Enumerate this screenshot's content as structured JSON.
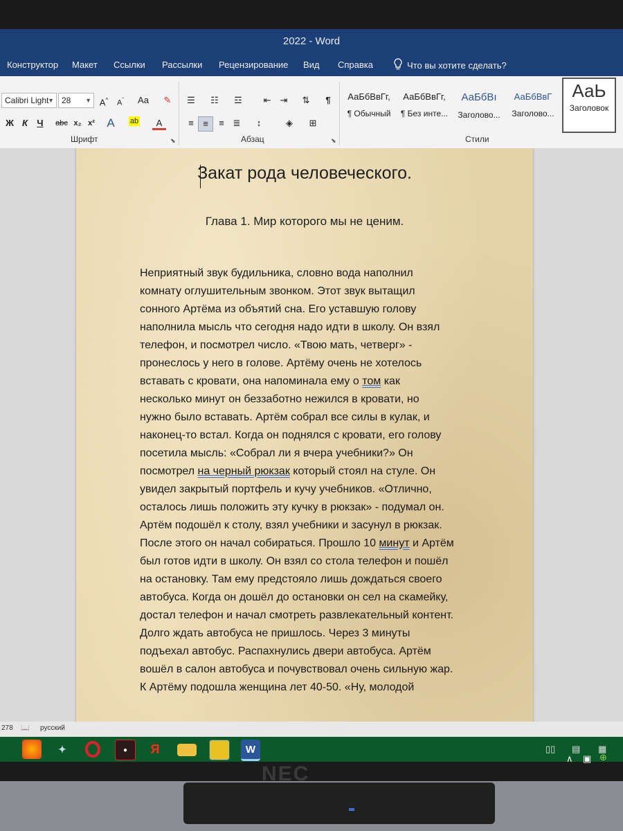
{
  "window": {
    "title": "2022 - Word"
  },
  "menu": {
    "items": [
      "Конструктор",
      "Макет",
      "Ссылки",
      "Рассылки",
      "Рецензирование",
      "Вид",
      "Справка"
    ],
    "tell_me": "Что вы хотите сделать?"
  },
  "ribbon": {
    "font_name": "Calibri Light",
    "font_size": "28",
    "change_case": "Aa",
    "bold": "Ж",
    "italic": "К",
    "underline": "Ч",
    "strike": "abc",
    "subscript": "x₂",
    "superscript": "x²",
    "font_group_label": "Шрифт",
    "paragraph_group_label": "Абзац",
    "styles_group_label": "Стили",
    "styles": [
      {
        "sample": "АаБбВвГг,",
        "name": "¶ Обычный"
      },
      {
        "sample": "АаБбВвГг,",
        "name": "¶ Без инте..."
      },
      {
        "sample": "АаБбВı",
        "name": "Заголово..."
      },
      {
        "sample": "АаБбВвГ",
        "name": "Заголово..."
      },
      {
        "sample": "АаЬ",
        "name": "Заголовок"
      }
    ]
  },
  "document": {
    "title": "Закат рода человеческого.",
    "chapter": "Глава 1. Мир которого мы не ценим.",
    "lines": [
      [
        "Неприятный звук будильника, словно вода наполнил"
      ],
      [
        "комнату оглушительным звонком. Этот звук вытащил"
      ],
      [
        "сонного Артёма из объятий сна. Его уставшую голову"
      ],
      [
        "наполнила мысль что сегодня надо идти в школу. Он взял"
      ],
      [
        "телефон, и посмотрел число. «Твою мать, четверг» -"
      ],
      [
        "пронеслось у него в голове. Артёму очень не хотелось"
      ],
      [
        "вставать с кровати, она напоминала ему о ",
        "том",
        " как"
      ],
      [
        "несколько минут он беззаботно нежился в кровати, но"
      ],
      [
        "нужно было вставать. Артём собрал все силы в кулак, и"
      ],
      [
        "наконец-то встал. Когда он поднялся с кровати, его голову"
      ],
      [
        "посетила мысль: «Собрал ли я вчера учебники?» Он"
      ],
      [
        "посмотрел ",
        "на черный рюкзак",
        " который стоял на стуле. Он"
      ],
      [
        "увидел закрытый портфель и кучу учебников. «Отлично,"
      ],
      [
        "осталось лишь положить эту кучку в рюкзак» - подумал он."
      ],
      [
        "Артём подошёл к столу, взял учебники и засунул в рюкзак."
      ],
      [
        "После этого он начал собираться. Прошло 10 ",
        "минут",
        " и Артём"
      ],
      [
        "был готов идти в школу. Он взял со стола телефон и пошёл"
      ],
      [
        "на остановку. Там ему предстояло лишь дождаться своего"
      ],
      [
        "автобуса. Когда он дошёл до остановки он сел на скамейку,"
      ],
      [
        "достал телефон и начал смотреть развлекательный контент."
      ],
      [
        "Долго ждать автобуса не пришлось. Через 3 минуты"
      ],
      [
        "подъехал автобус. Распахнулись двери автобуса. Артём"
      ],
      [
        "вошёл в салон автобуса и почувствовал очень сильную жар."
      ],
      [
        "К Артёму подошла женщина лет 40-50. «Ну, молодой"
      ]
    ]
  },
  "status": {
    "words": "278",
    "language": "русский"
  },
  "taskbar": {
    "apps": [
      "firefox-icon",
      "qbittorrent-icon",
      "opera-icon",
      "camera-app-icon",
      "yandex-icon",
      "file-explorer-icon",
      "folder-app-icon",
      "word-icon"
    ],
    "yandex_label": "Я",
    "word_label": "W"
  },
  "monitor": {
    "brand": "NEC"
  },
  "colors": {
    "title_bar": "#1d3f78",
    "ribbon": "#f3f3f3",
    "page": "#e4d3a8",
    "taskbar": "#0c5a2a",
    "spell_underline": "#3b6fc7"
  }
}
